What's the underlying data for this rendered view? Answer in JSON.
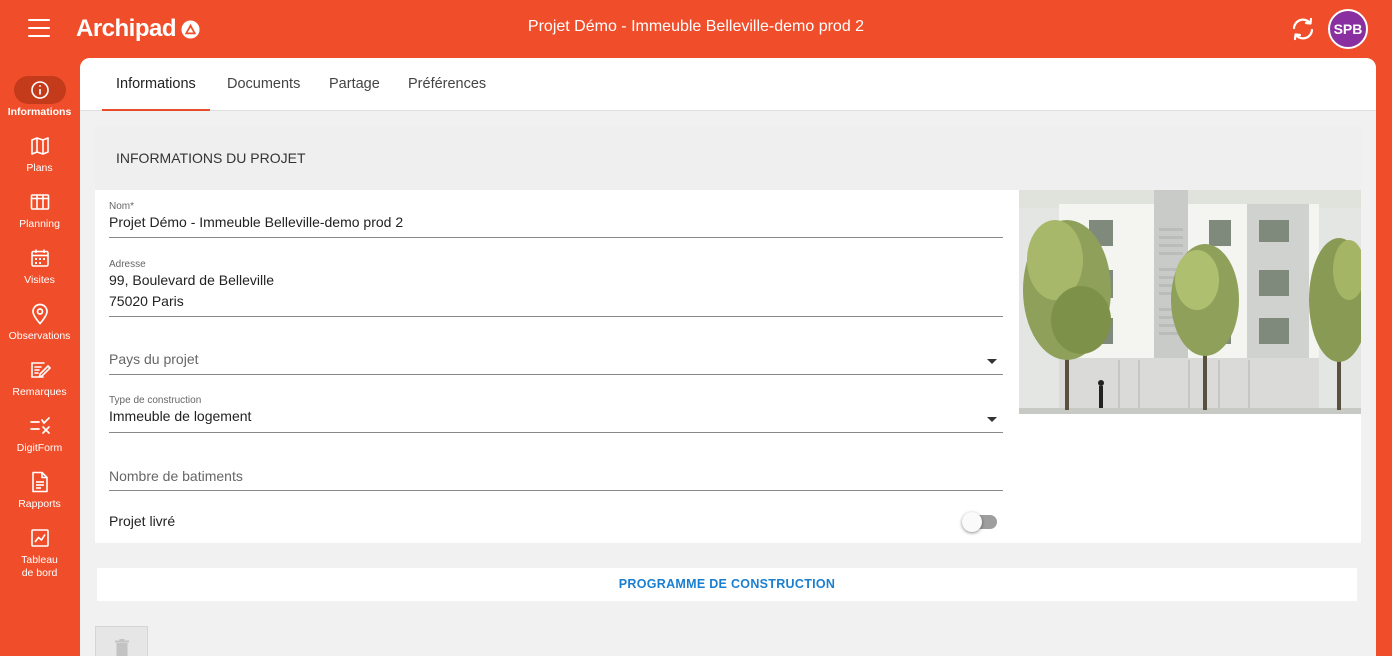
{
  "app": {
    "logo_text": "Archipad",
    "project_title": "Projet Démo - Immeuble Belleville-demo prod 2",
    "user_initials": "SPB",
    "accent_color": "#f04e2a",
    "avatar_color": "#8a2f9f"
  },
  "sidebar": {
    "items": [
      {
        "label": "Informations",
        "icon": "info-icon",
        "active": true
      },
      {
        "label": "Plans",
        "icon": "map-icon"
      },
      {
        "label": "Planning",
        "icon": "planning-icon"
      },
      {
        "label": "Visites",
        "icon": "calendar-icon"
      },
      {
        "label": "Observations",
        "icon": "location-pin-icon"
      },
      {
        "label": "Remarques",
        "icon": "edit-note-icon"
      },
      {
        "label": "DigitForm",
        "icon": "checklist-icon"
      },
      {
        "label": "Rapports",
        "icon": "document-icon"
      },
      {
        "label": "Tableau de bord",
        "icon": "chart-icon"
      }
    ]
  },
  "tabs": [
    {
      "label": "Informations",
      "active": true
    },
    {
      "label": "Documents"
    },
    {
      "label": "Partage"
    },
    {
      "label": "Préférences"
    }
  ],
  "section": {
    "title": "INFORMATIONS DU PROJET"
  },
  "form": {
    "name_label": "Nom*",
    "name_value": "Projet Démo - Immeuble Belleville-demo prod 2",
    "address_label": "Adresse",
    "address_line1": "99, Boulevard de Belleville",
    "address_line2": "75020 Paris",
    "country_placeholder": "Pays du projet",
    "construction_type_label": "Type de construction",
    "construction_type_value": "Immeuble de logement",
    "buildings_placeholder": "Nombre de batiments",
    "delivered_label": "Projet livré",
    "delivered": false
  },
  "program_button": "PROGRAMME DE CONSTRUCTION",
  "delete_icon": "trash-icon"
}
